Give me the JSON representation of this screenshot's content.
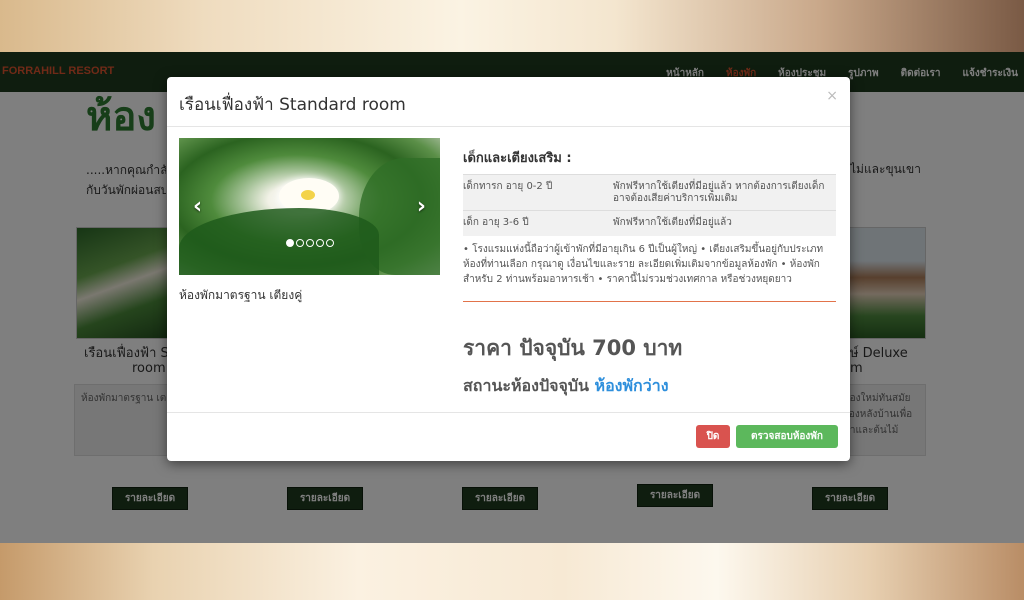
{
  "navbar": {
    "brand": "FORRAHILL RESORT",
    "links": [
      "หน้าหลัก",
      "ห้องพัก",
      "ห้องประชุม",
      "รูปภาพ",
      "ติดต่อเรา",
      "แจ้งชำระเงิน"
    ],
    "active_index": 1
  },
  "page": {
    "heading": "ห้อง",
    "intro_left": ".....หากคุณกำลัง",
    "intro_left_2": "กับวันพักผ่อนสบ",
    "intro_right": "ไม่และขุนเขา",
    "rooms": [
      {
        "title": "เรือนเฟื่องฟ้า S",
        "title_2": "room",
        "desc": "ห้องพักมาตรฐาน เต"
      },
      {
        "title": "กษ์ Deluxe",
        "title_2": "om",
        "desc": "ห้องใหม่ทันสมัย ย้องหลังบ้านเพื่อ น้ำและต้นไม้"
      }
    ],
    "detail_buttons": [
      "รายละเอียด",
      "รายละเอียด",
      "รายละเอียด",
      "รายละเอียด",
      "รายละเอียด"
    ]
  },
  "modal": {
    "title": "เรือนเฟื่องฟ้า Standard room",
    "close_symbol": "×",
    "carousel": {
      "prev_symbol": "‹",
      "next_symbol": "›",
      "slide_count": 5,
      "active_slide": 1
    },
    "caption": "ห้องพักมาตรฐาน เตียงคู่",
    "extras_heading": "เด็กและเตียงเสริม :",
    "extras": [
      {
        "age": "เด็กทารก อายุ 0-2 ปี",
        "policy": "พักฟรีหากใช้เตียงที่มีอยู่แล้ว หากต้องการเตียงเด็ก อาจต้องเสียค่าบริการเพิ่มเติม"
      },
      {
        "age": "เด็ก อายุ 3-6 ปี",
        "policy": "พักฟรีหากใช้เตียงที่มีอยู่แล้ว"
      }
    ],
    "notes": "• โรงแรมแห่งนี้ถือว่าผู้เข้าพักที่มีอายุเกิน 6 ปีเป็นผู้ใหญ่ • เตียงเสริมขึ้นอยู่กับประเภทห้องที่ท่านเลือก กรุณาดู เงื่อนไขและราย ละเอียดเพิ่มเติมจากข้อมูลห้องพัก • ห้องพักสำหรับ 2 ท่านพร้อมอาหารเช้า • ราคานี้ไม่รวมช่วงเทศกาล หรือช่วงหยุดยาว",
    "price": "ราคา ปัจจุบัน 700 บาท",
    "status_label": "สถานะห้องปัจจุบัน",
    "status_value": "ห้องพักว่าง",
    "footer": {
      "close_label": "ปิด",
      "check_label": "ตรวจสอบห้องพัก"
    }
  },
  "colors": {
    "navbar": "#1f3a1f",
    "brand": "#e0552e",
    "status_value": "#2e8fdc",
    "close_button": "#d9534f",
    "check_button": "#5cb85c"
  }
}
